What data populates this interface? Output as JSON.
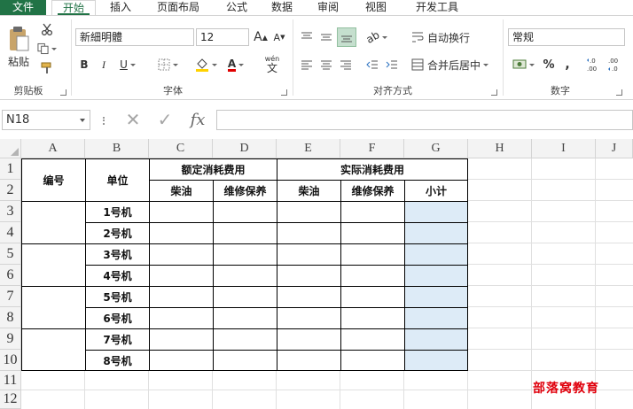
{
  "tabs": [
    "文件",
    "开始",
    "插入",
    "页面布局",
    "公式",
    "数据",
    "审阅",
    "视图",
    "开发工具"
  ],
  "ribbon": {
    "clipboard": {
      "paste": "粘贴",
      "label": "剪贴板"
    },
    "font": {
      "name": "新細明體",
      "size": "12",
      "label": "字体",
      "bold": "B",
      "italic": "I",
      "underline": "U",
      "wen": "wén",
      "wen2": "文"
    },
    "align": {
      "wrap": "自动换行",
      "merge": "合并后居中",
      "label": "对齐方式"
    },
    "number": {
      "format": "常规",
      "label": "数字",
      "percent": "%",
      "comma": ",",
      "inc": ".0→.00",
      "dec": ".00→.0"
    }
  },
  "formula_bar": {
    "cell_ref": "N18",
    "fx": "fx",
    "value": ""
  },
  "columns": [
    "A",
    "B",
    "C",
    "D",
    "E",
    "F",
    "G",
    "H",
    "I",
    "J"
  ],
  "rows": [
    "1",
    "2",
    "3",
    "4",
    "5",
    "6",
    "7",
    "8",
    "9",
    "10",
    "11",
    "12"
  ],
  "table": {
    "header_id": "编号",
    "header_unit": "单位",
    "header_quota": "额定消耗费用",
    "header_actual": "实际消耗费用",
    "sub_diesel_1": "柴油",
    "sub_maint_1": "维修保养",
    "sub_diesel_2": "柴油",
    "sub_maint_2": "维修保养",
    "sub_total": "小计",
    "units": [
      "1号机",
      "2号机",
      "3号机",
      "4号机",
      "5号机",
      "6号机",
      "7号机",
      "8号机"
    ]
  },
  "watermark": "部落窝教育",
  "colors": {
    "accent": "#217346",
    "highlight": "#ddebf7",
    "watermark": "#e0000c"
  }
}
